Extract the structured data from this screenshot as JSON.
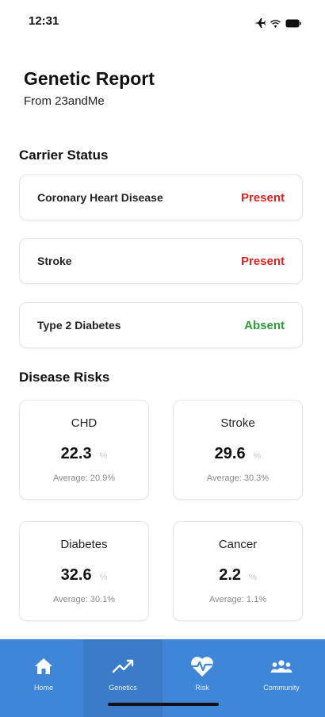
{
  "status_bar": {
    "time": "12:31"
  },
  "header": {
    "title": "Genetic Report",
    "subtitle": "From 23andMe"
  },
  "carrier_section": {
    "title": "Carrier Status",
    "items": [
      {
        "name": "Coronary Heart Disease",
        "status": "Present",
        "status_color": "#e02424"
      },
      {
        "name": "Stroke",
        "status": "Present",
        "status_color": "#e02424"
      },
      {
        "name": "Type 2 Diabetes",
        "status": "Absent",
        "status_color": "#2e9a3a"
      }
    ]
  },
  "risks_section": {
    "title": "Disease Risks",
    "unit": "%",
    "cards": [
      {
        "name": "CHD",
        "value": "22.3",
        "average": "Average: 20.9%"
      },
      {
        "name": "Stroke",
        "value": "29.6",
        "average": "Average: 30.3%"
      },
      {
        "name": "Diabetes",
        "value": "32.6",
        "average": "Average: 30.1%"
      },
      {
        "name": "Cancer",
        "value": "2.2",
        "average": "Average: 1.1%"
      }
    ]
  },
  "tab_bar": {
    "background": "#3f86d8",
    "tabs": [
      {
        "label": "Home",
        "icon": "home-icon"
      },
      {
        "label": "Genetics",
        "icon": "trend-line-icon",
        "active": true
      },
      {
        "label": "Risk",
        "icon": "heart-pulse-icon"
      },
      {
        "label": "Community",
        "icon": "community-icon"
      }
    ]
  }
}
